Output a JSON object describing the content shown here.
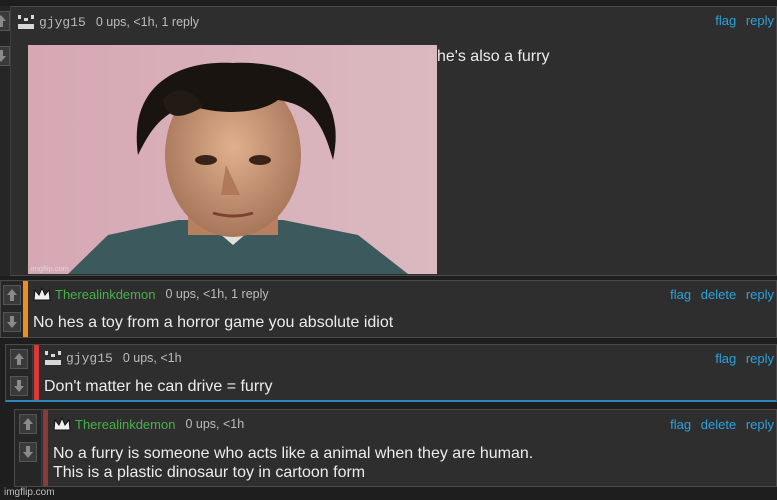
{
  "comments": [
    {
      "user": "gjyg15",
      "meta": "0 ups, <1h, 1 reply",
      "actions": [
        "flag",
        "reply"
      ],
      "text": "he's also a furry",
      "image_watermark": "imgflip.com"
    },
    {
      "user": "Therealinkdemon",
      "meta": "0 ups, <1h, 1 reply",
      "actions": [
        "flag",
        "delete",
        "reply"
      ],
      "text": "No hes a toy from a horror game you absolute idiot"
    },
    {
      "user": "gjyg15",
      "meta": "0 ups, <1h",
      "actions": [
        "flag",
        "reply"
      ],
      "text": "Don't matter he can drive = furry"
    },
    {
      "user": "Therealinkdemon",
      "meta": "0 ups, <1h",
      "actions": [
        "flag",
        "delete",
        "reply"
      ],
      "text_line1": "No a furry is someone who acts like a animal when they are human.",
      "text_line2": "This is a plastic dinosaur toy in cartoon form"
    }
  ],
  "footer": {
    "watermark": "imgflip.com"
  },
  "colors": {
    "accent_orange": "#f28c1a",
    "accent_red": "#d83a3a",
    "accent_darkred": "#8a3a3a",
    "link_blue": "#2ba3dd",
    "username_green": "#47b24a"
  }
}
